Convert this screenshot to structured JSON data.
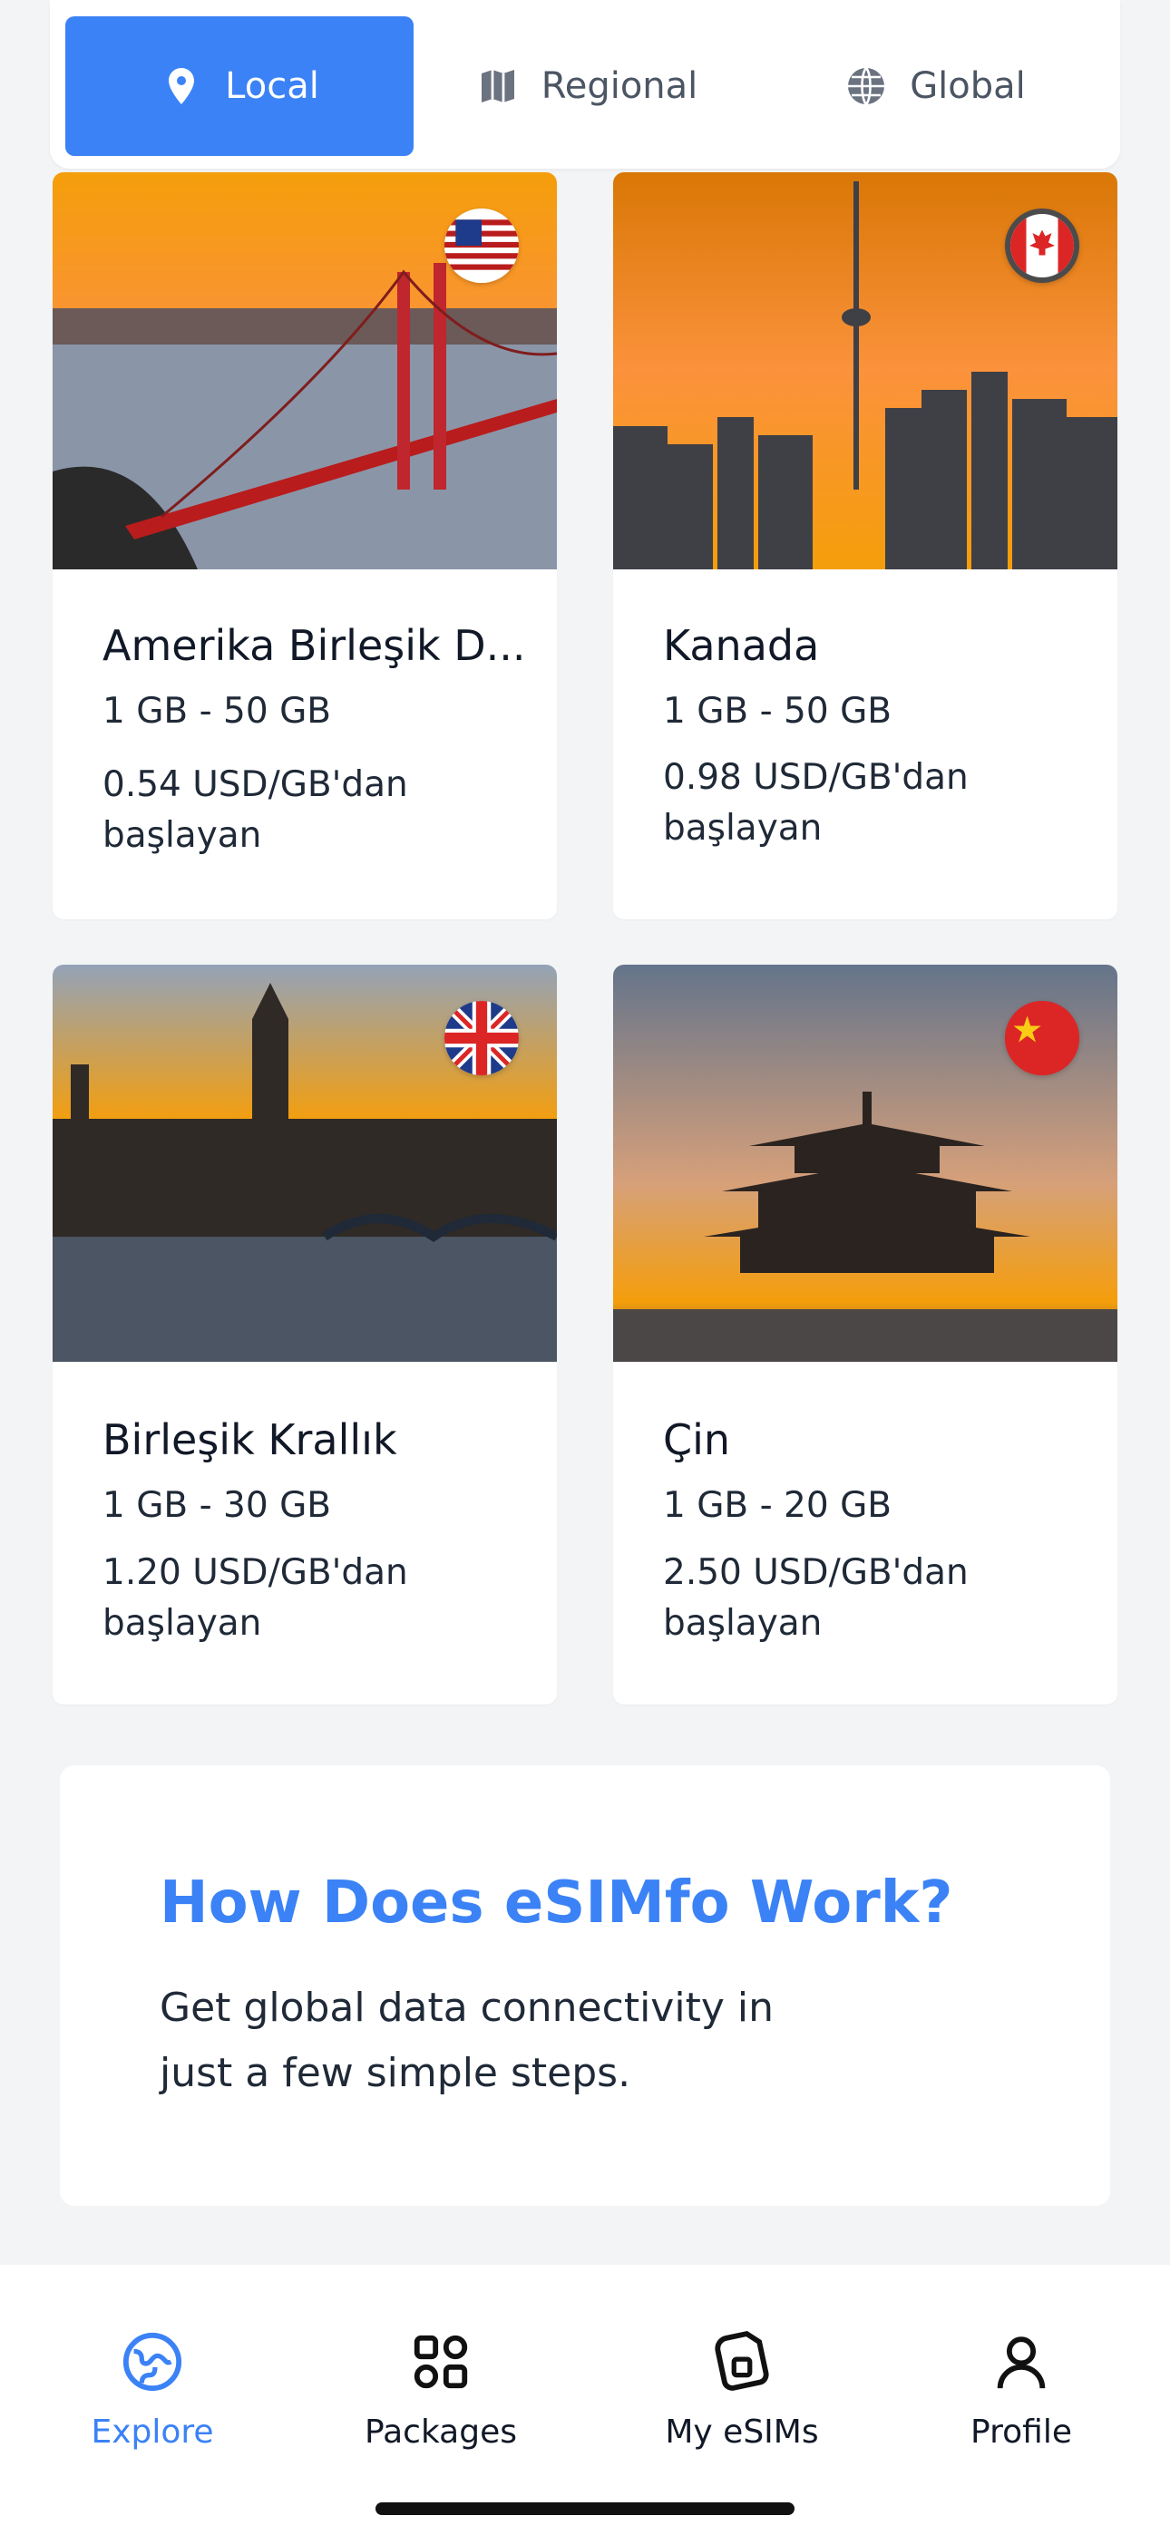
{
  "tabs": [
    {
      "label": "Local",
      "icon": "location-pin-icon",
      "active": true
    },
    {
      "label": "Regional",
      "icon": "map-icon",
      "active": false
    },
    {
      "label": "Global",
      "icon": "globe-icon",
      "active": false
    }
  ],
  "destinations": [
    {
      "name": "Amerika Birleşik D...",
      "range": "1 GB - 50 GB",
      "price": "0.54 USD/GB'dan başlayan",
      "flag": "us-flag-icon"
    },
    {
      "name": "Kanada",
      "range": "1 GB - 50 GB",
      "price": "0.98 USD/GB'dan başlayan",
      "flag": "canada-flag-icon"
    },
    {
      "name": "Birleşik Krallık",
      "range": "1 GB - 30 GB",
      "price": "1.20 USD/GB'dan başlayan",
      "flag": "uk-flag-icon"
    },
    {
      "name": "Çin",
      "range": "1 GB - 20 GB",
      "price": "2.50 USD/GB'dan başlayan",
      "flag": "china-flag-icon"
    }
  ],
  "how": {
    "title": "How Does eSIMfo Work?",
    "description": "Get global data connectivity in just a few simple steps."
  },
  "nav": [
    {
      "label": "Explore",
      "icon": "globe-explore-icon",
      "active": true
    },
    {
      "label": "Packages",
      "icon": "grid-icon",
      "active": false
    },
    {
      "label": "My eSIMs",
      "icon": "sim-card-icon",
      "active": false
    },
    {
      "label": "Profile",
      "icon": "user-icon",
      "active": false
    }
  ],
  "colors": {
    "accent": "#3b82f6",
    "background": "#f3f4f6"
  }
}
